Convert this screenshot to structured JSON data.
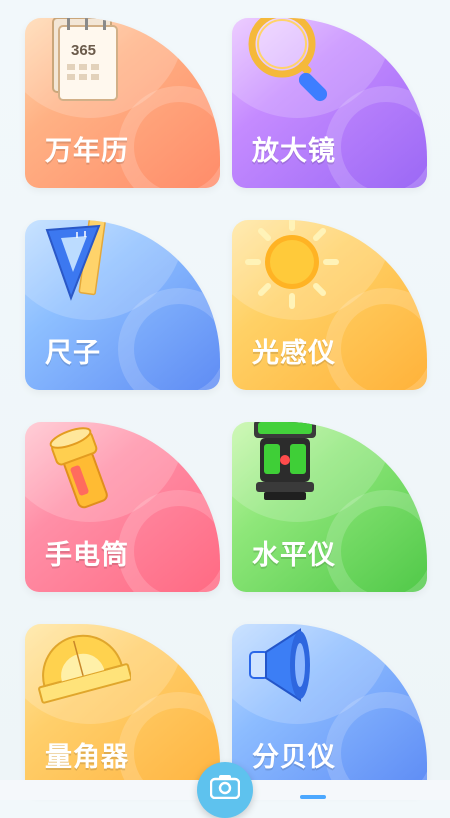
{
  "tools": [
    {
      "label": "万年历",
      "icon": "calendar-icon",
      "color": "#ff9c72"
    },
    {
      "label": "放大镜",
      "icon": "magnifier-icon",
      "color": "#b27cff"
    },
    {
      "label": "尺子",
      "icon": "ruler-icon",
      "color": "#75a9fb"
    },
    {
      "label": "光感仪",
      "icon": "sun-icon",
      "color": "#ffc24d"
    },
    {
      "label": "手电筒",
      "icon": "flashlight-icon",
      "color": "#ff7f98"
    },
    {
      "label": "水平仪",
      "icon": "laser-level-icon",
      "color": "#6fd85f"
    },
    {
      "label": "量角器",
      "icon": "protractor-icon",
      "color": "#ffc14f"
    },
    {
      "label": "分贝仪",
      "icon": "speaker-icon",
      "color": "#75a6fb"
    }
  ],
  "calendar": {
    "number": "365"
  },
  "bottom_nav": {
    "center_icon": "camera-icon"
  }
}
